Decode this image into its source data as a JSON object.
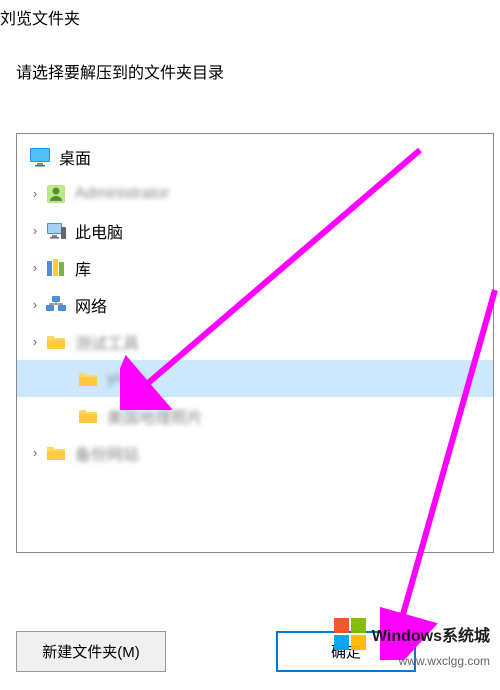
{
  "dialog": {
    "title": "刘览文件夹",
    "instruction": "请选择要解压到的文件夹目录"
  },
  "tree": {
    "root": {
      "label": "桌面"
    },
    "items": [
      {
        "label": "Administrator",
        "icon": "user",
        "expandable": true
      },
      {
        "label": "此电脑",
        "icon": "pc",
        "expandable": true
      },
      {
        "label": "库",
        "icon": "library",
        "expandable": true
      },
      {
        "label": "网络",
        "icon": "network",
        "expandable": true
      },
      {
        "label": "测试工具",
        "icon": "folder",
        "expandable": true
      },
      {
        "label": "yishu",
        "icon": "folder",
        "expandable": false,
        "selected": true,
        "indent": true
      },
      {
        "label": "美国地理照片",
        "icon": "folder",
        "expandable": false,
        "indent": true
      },
      {
        "label": "备份网站",
        "icon": "folder",
        "expandable": true
      }
    ]
  },
  "buttons": {
    "new_folder": "新建文件夹(M)",
    "ok": "确定"
  },
  "watermark": {
    "text": "Windows系统城",
    "url": "www.wxclgg.com"
  },
  "annotations": {
    "arrow_color": "#ff00ff"
  }
}
